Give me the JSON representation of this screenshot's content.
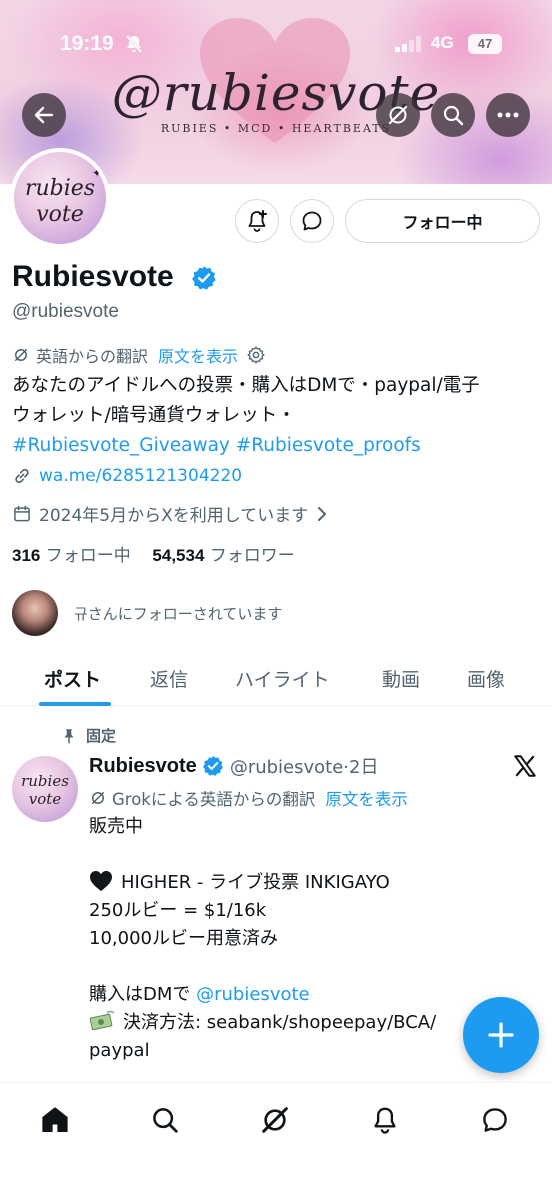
{
  "status_bar": {
    "time": "19:19",
    "network": "4G",
    "battery": "47"
  },
  "banner": {
    "title": "@rubiesvote",
    "subtitle": "RUBIES • MCD • HEARTBEATS"
  },
  "avatar": {
    "line1": "rubies",
    "line2": "vote"
  },
  "profile": {
    "follow_button": "フォロー中",
    "name": "Rubiesvote",
    "handle": "@rubiesvote",
    "translate_label": "英語からの翻訳",
    "show_original": "原文を表示",
    "bio_line1": "あなたのアイドルへの投票・購入はDMで・paypal/電子",
    "bio_line2": "ウォレット/暗号通貨ウォレット・",
    "bio_tag1": "#Rubiesvote_Giveaway",
    "bio_tag2": "#Rubiesvote_proofs",
    "link": "wa.me/6285121304220",
    "joined": "2024年5月からXを利用しています",
    "following_count": "316",
    "following_label": "フォロー中",
    "followers_count": "54,534",
    "followers_label": "フォロワー",
    "followed_by_text": "규さんにフォローされています"
  },
  "tabs": [
    {
      "label": "ポスト"
    },
    {
      "label": "返信"
    },
    {
      "label": "ハイライト"
    },
    {
      "label": "動画"
    },
    {
      "label": "画像"
    }
  ],
  "post": {
    "pinned_label": "固定",
    "name": "Rubiesvote",
    "handle_time": "@rubiesvote·2日",
    "translate_label": "Grokによる英語からの翻訳",
    "show_original": "原文を表示",
    "line1": "販売中",
    "line2": "HIGHER - ライブ投票 INKIGAYO",
    "line3": "250ルビー = $1/16k",
    "line4": "10,000ルビー用意済み",
    "line5_prefix": "購入はDMで",
    "line5_mention": "@rubiesvote",
    "line6": "決済方法: seabank/shopeepay/BCA/",
    "line7": "paypal"
  },
  "colors": {
    "accent": "#1d9bf0",
    "text": "#0f1419",
    "secondary": "#536471"
  },
  "icons": [
    "back-arrow-icon",
    "grok-icon",
    "search-icon",
    "more-icon",
    "notification-plus-icon",
    "message-icon",
    "verified-badge-icon",
    "link-icon",
    "calendar-icon",
    "pin-icon",
    "x-logo-icon",
    "home-icon",
    "explore-icon",
    "bell-icon",
    "chat-icon",
    "compose-plus-icon"
  ]
}
